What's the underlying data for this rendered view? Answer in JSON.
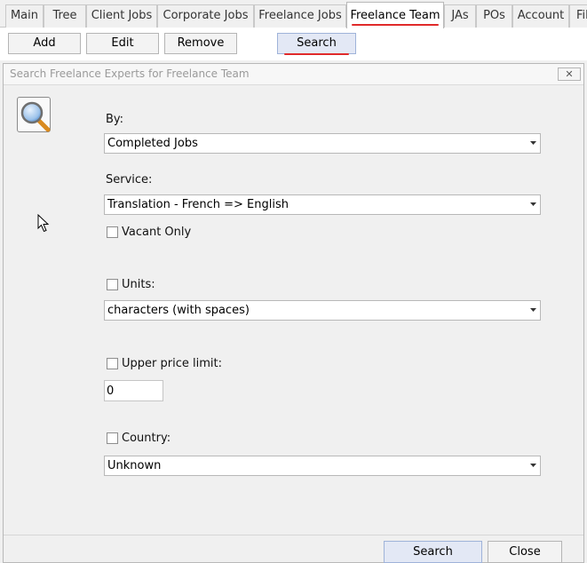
{
  "tabs": [
    {
      "label": "Main"
    },
    {
      "label": "Tree"
    },
    {
      "label": "Client Jobs"
    },
    {
      "label": "Corporate Jobs"
    },
    {
      "label": "Freelance Jobs"
    },
    {
      "label": "Freelance Team"
    },
    {
      "label": "JAs"
    },
    {
      "label": "POs"
    },
    {
      "label": "Account"
    },
    {
      "label": "Fil"
    }
  ],
  "active_tab": "Freelance Team",
  "toolbar": {
    "add": "Add",
    "edit": "Edit",
    "remove": "Remove",
    "search": "Search"
  },
  "dialog": {
    "title": "Search Freelance Experts for Freelance Team",
    "close_glyph": "✕",
    "by": {
      "label": "By:",
      "value": "Completed Jobs"
    },
    "service": {
      "label": "Service:",
      "value": "Translation - French => English"
    },
    "vacant_only": {
      "label": "Vacant Only",
      "checked": false
    },
    "units": {
      "label": "Units:",
      "checked": false,
      "value": "characters (with spaces)"
    },
    "upper_price_limit": {
      "label": "Upper price limit:",
      "checked": false,
      "value": "0"
    },
    "country": {
      "label": "Country:",
      "checked": false,
      "value": "Unknown"
    },
    "search_button": "Search",
    "close_button": "Close"
  },
  "icons": {
    "dialog_icon": "magnifier-icon",
    "dropdown_arrow": "chevron-down-icon",
    "cursor": "mouse-pointer-icon"
  },
  "colors": {
    "accent_underline": "#e02a2a",
    "primary_button": "#e3e8f5",
    "magnifier_lens": "#4a86c8",
    "magnifier_handle": "#d98a1f"
  }
}
